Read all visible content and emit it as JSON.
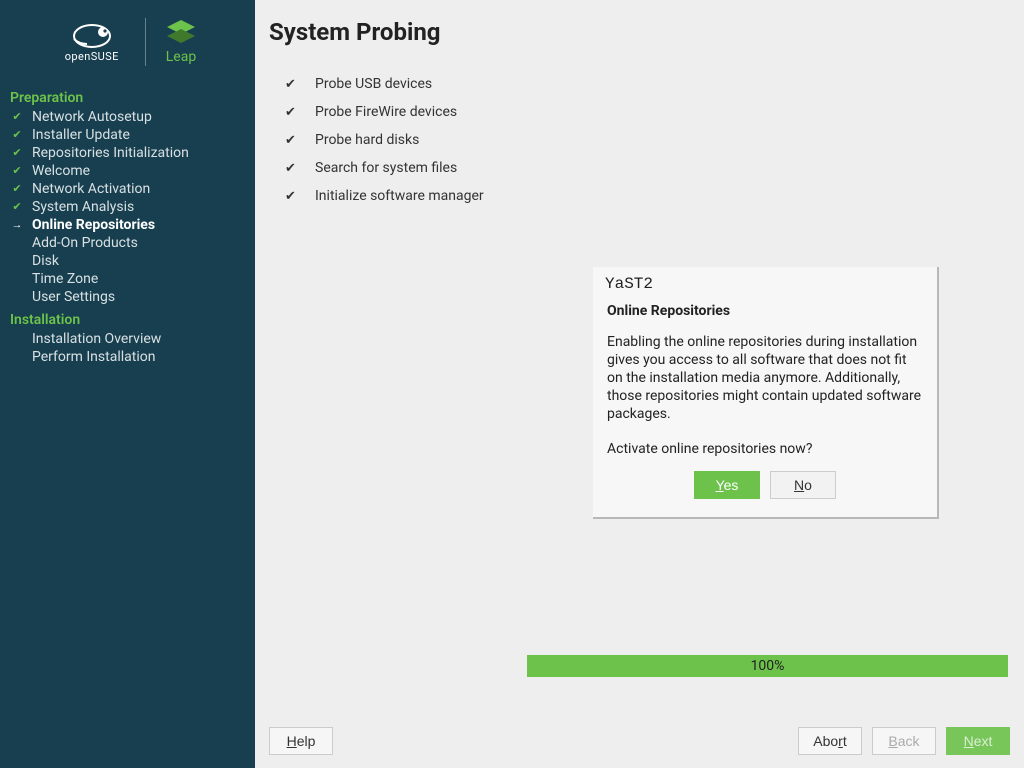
{
  "brand": {
    "suse": "openSUSE",
    "leap": "Leap"
  },
  "sidebar": {
    "sections": [
      {
        "heading": "Preparation",
        "items": [
          {
            "label": "Network Autosetup",
            "state": "done"
          },
          {
            "label": "Installer Update",
            "state": "done"
          },
          {
            "label": "Repositories Initialization",
            "state": "done"
          },
          {
            "label": "Welcome",
            "state": "done"
          },
          {
            "label": "Network Activation",
            "state": "done"
          },
          {
            "label": "System Analysis",
            "state": "done"
          },
          {
            "label": "Online Repositories",
            "state": "current"
          },
          {
            "label": "Add-On Products",
            "state": "future"
          },
          {
            "label": "Disk",
            "state": "future"
          },
          {
            "label": "Time Zone",
            "state": "future"
          },
          {
            "label": "User Settings",
            "state": "future"
          }
        ]
      },
      {
        "heading": "Installation",
        "items": [
          {
            "label": "Installation Overview",
            "state": "future"
          },
          {
            "label": "Perform Installation",
            "state": "future"
          }
        ]
      }
    ]
  },
  "page": {
    "title": "System Probing",
    "probes": [
      "Probe USB devices",
      "Probe FireWire devices",
      "Probe hard disks",
      "Search for system files",
      "Initialize software manager"
    ]
  },
  "dialog": {
    "title": "YaST2",
    "heading": "Online Repositories",
    "text": "Enabling the online repositories during installation gives you access to all software that does not fit on the installation media anymore. Additionally, those repositories might contain updated software packages.",
    "question": "Activate online repositories now?",
    "yes": "Yes",
    "no": "No"
  },
  "progress": {
    "text": "100%"
  },
  "footer": {
    "help": "Help",
    "abort": "Abort",
    "back": "Back",
    "next": "Next"
  }
}
